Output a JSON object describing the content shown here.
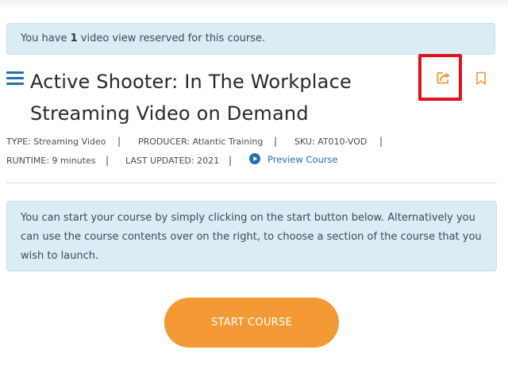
{
  "notice": {
    "prefix": "You have ",
    "count": "1",
    "suffix": " video view reserved for this course."
  },
  "course": {
    "title_line1": "Active Shooter: In The Workplace",
    "title_line2": "Streaming Video on Demand"
  },
  "meta": {
    "type": "TYPE: Streaming Video",
    "producer": "PRODUCER: Atlantic Training",
    "sku": "SKU: AT010-VOD",
    "runtime": "RUNTIME: 9 minutes",
    "last_updated": "LAST UPDATED: 2021",
    "separator": "|"
  },
  "preview": {
    "label": "Preview Course"
  },
  "info_text": "You can start your course by simply clicking on the start button below. Alternatively you can use the course contents over on the right, to choose a section of the course that you wish to launch.",
  "start_button": {
    "label": "START COURSE"
  },
  "icons": {
    "menu": "hamburger-menu-icon",
    "share": "share-icon",
    "bookmark": "bookmark-icon",
    "play": "play-circle-icon"
  },
  "colors": {
    "accent_blue": "#1f6fb5",
    "accent_orange": "#f39a35",
    "highlight_red": "#e1101a",
    "panel_blue": "#daedf4"
  }
}
